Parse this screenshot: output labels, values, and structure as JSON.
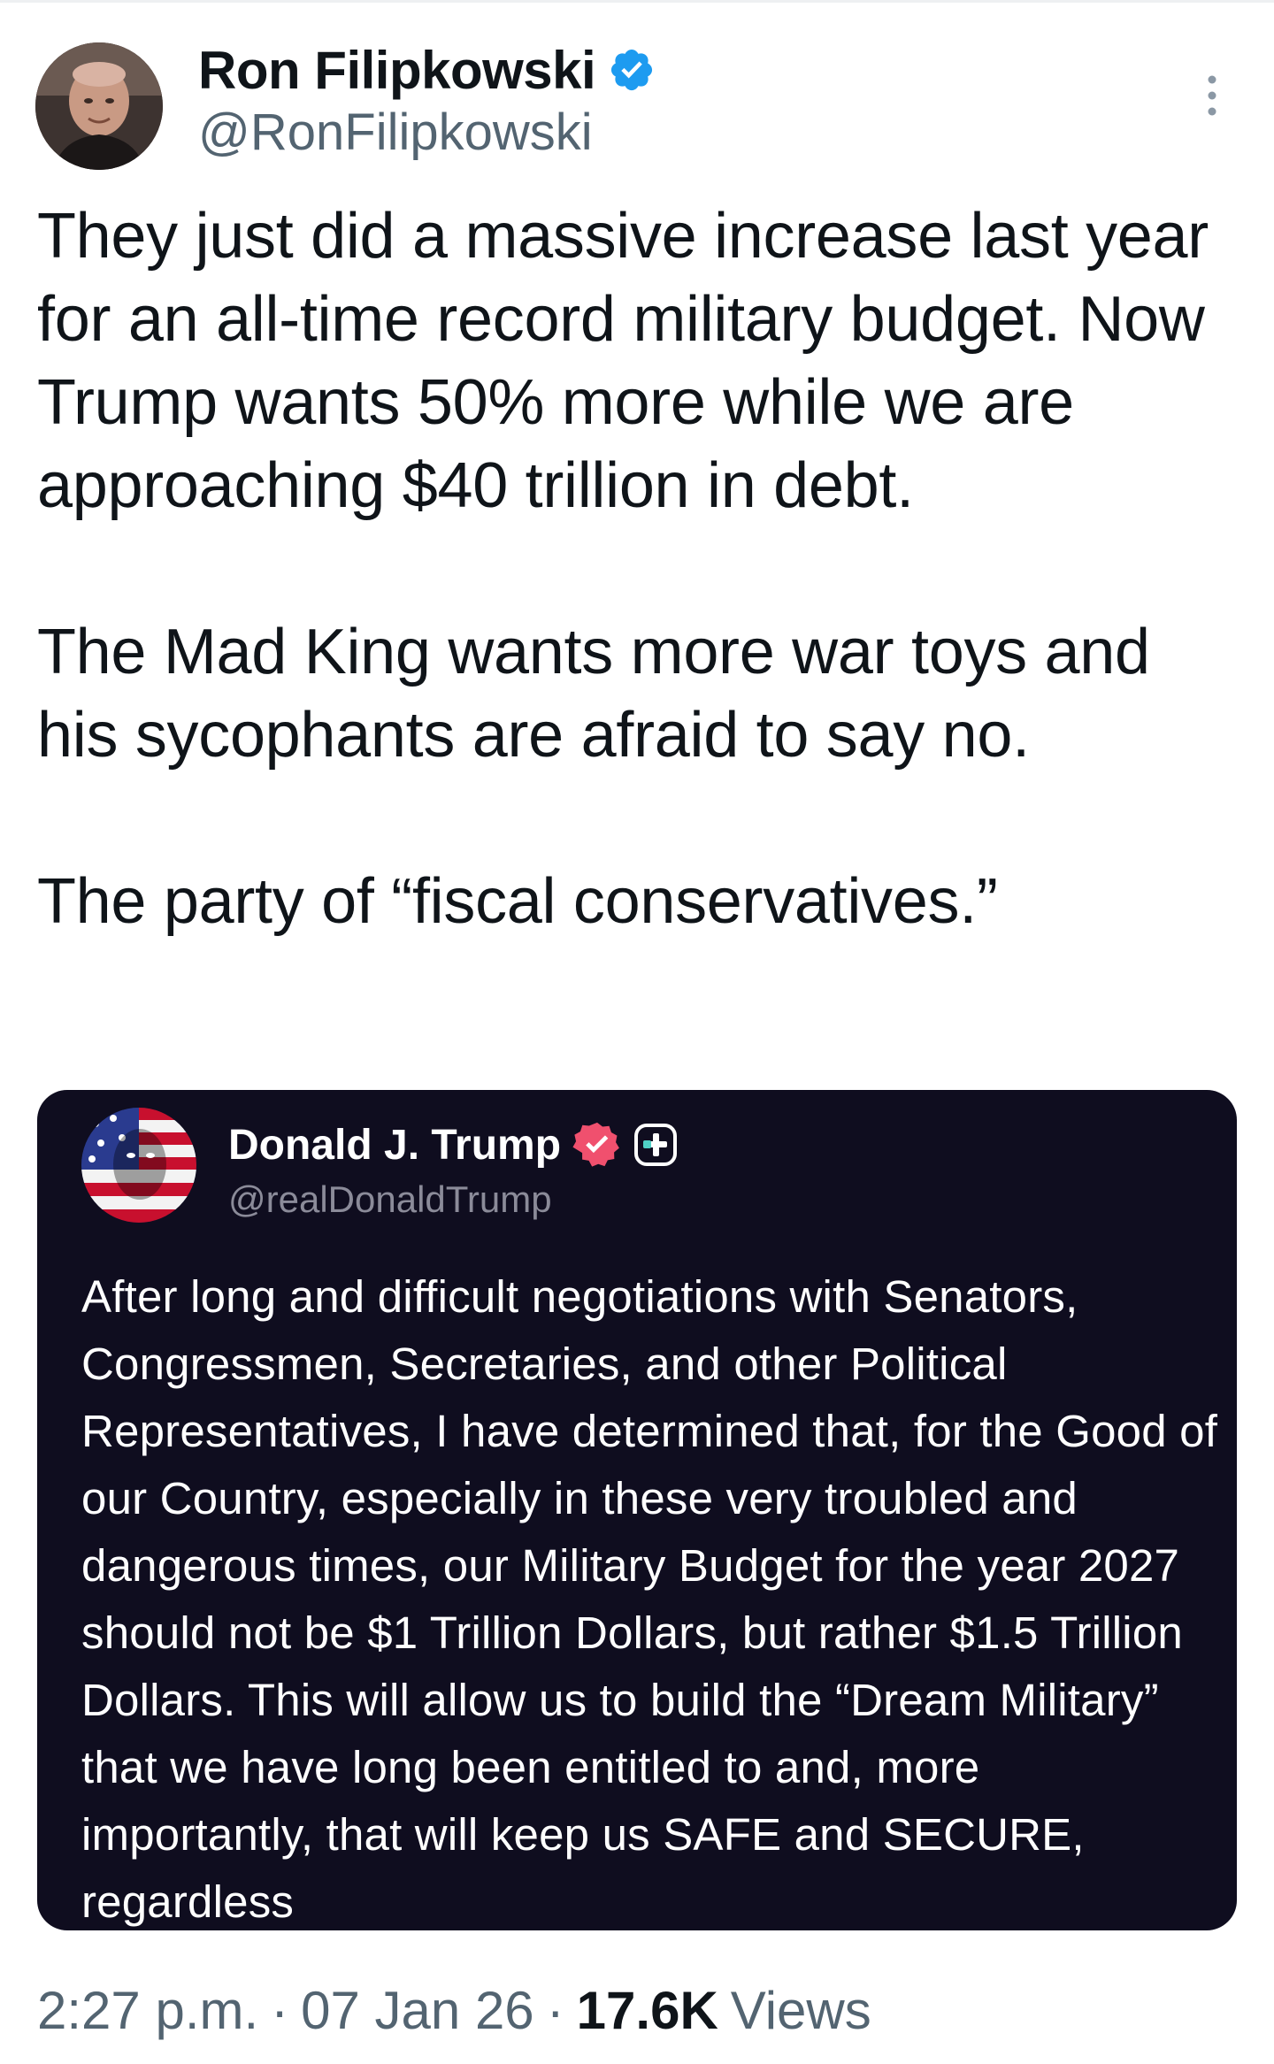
{
  "author": {
    "name": "Ron Filipkowski",
    "handle": "@RonFilipkowski",
    "verified_color": "#1d9bf0"
  },
  "tweet": {
    "paragraphs": [
      "They just did a massive increase last year for an all-time record military budget. Now Trump wants 50% more while we are approaching $40 trillion in debt.",
      "The Mad King wants more war toys and his sycophants are afraid to say no.",
      "The party of “fiscal conservatives.”"
    ]
  },
  "quote": {
    "name": "Donald J. Trump",
    "handle": "@realDonaldTrump",
    "badge_color": "#f0506e",
    "background": "#0f0d1f",
    "text": "After long and difficult negotiations with Senators, Congressmen, Secretaries, and other Political Representatives, I have determined that, for the Good of our Country, especially in these very troubled and dangerous times, our Military Budget for the year 2027 should not be $1 Trillion Dollars, but rather $1.5 Trillion Dollars. This will allow us to build the “Dream Military” that we have long been entitled to and, more importantly, that will keep us SAFE and SECURE, regardless"
  },
  "meta": {
    "time": "2:27 p.m.",
    "separator": "·",
    "date": "07 Jan 26",
    "views_count": "17.6K",
    "views_label": "Views"
  },
  "icons": {
    "more": "more-vertical-icon",
    "verified": "verified-badge-icon",
    "quote_verified": "truth-verified-badge-icon",
    "plus": "plus-badge-icon"
  }
}
